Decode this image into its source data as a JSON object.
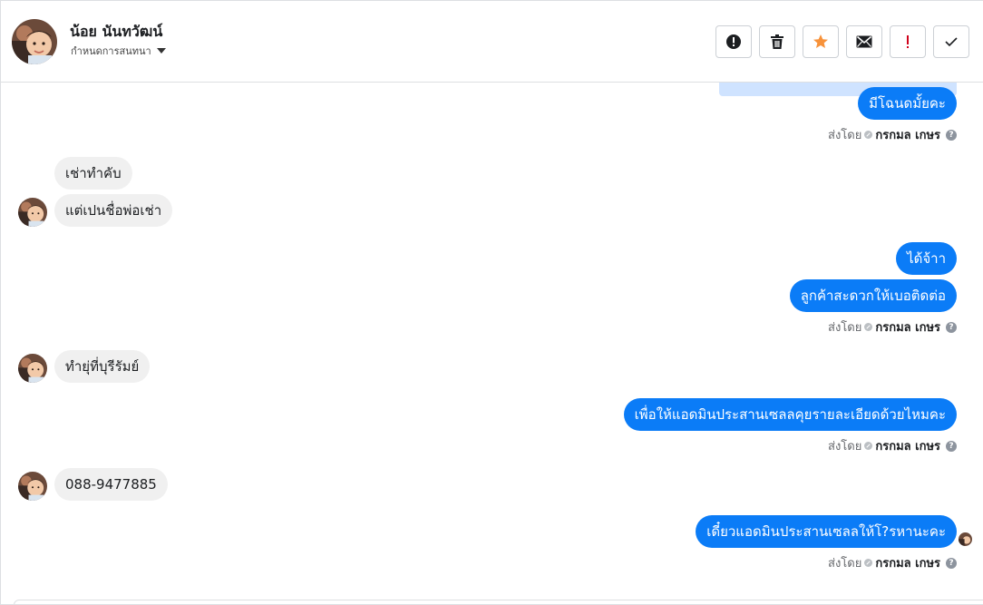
{
  "header": {
    "contact_name": "น้อย นันทวัฒน์",
    "assign_label": "กำหนดการสนทนา",
    "avatar_icon": "profile-photo-icon",
    "actions": [
      {
        "name": "spam-button",
        "icon": "alert-circle-icon"
      },
      {
        "name": "delete-button",
        "icon": "trash-icon"
      },
      {
        "name": "star-button",
        "icon": "star-icon",
        "color": "#f7923a"
      },
      {
        "name": "unread-button",
        "icon": "envelope-icon"
      },
      {
        "name": "important-button",
        "icon": "exclamation-icon",
        "color": "#d0021b"
      },
      {
        "name": "done-button",
        "icon": "check-icon"
      }
    ]
  },
  "sent_by_label": "ส่งโดย",
  "agent_name": "กรกมล เกษร",
  "help_glyph": "?",
  "messages": [
    {
      "dir": "out",
      "text": "มีโฉนดมั้ยคะ"
    },
    {
      "dir": "in",
      "text": "เช่าทำคับ"
    },
    {
      "dir": "in",
      "text": "แต่เปนชื่อพ่อเช่า"
    },
    {
      "dir": "out",
      "text": "ได้จ้าา"
    },
    {
      "dir": "out",
      "text": "ลูกค้าสะดวกให้เบอติดต่อ"
    },
    {
      "dir": "in",
      "text": "ทำยุ่ที่บุรีรัมย์"
    },
    {
      "dir": "out",
      "text": "เพื่อให้แอดมินประสานเซลลคุยรายละเอียดด้วยไหมคะ"
    },
    {
      "dir": "in",
      "text": "088-9477885"
    },
    {
      "dir": "out",
      "text": "เดี๋ยวแอดมินประสานเซลลให้โ?รหานะคะ"
    }
  ],
  "colors": {
    "outgoing_bubble": "#0b7cf7",
    "incoming_bubble": "#f0f0f0",
    "star": "#f7923a",
    "important": "#d0021b"
  }
}
